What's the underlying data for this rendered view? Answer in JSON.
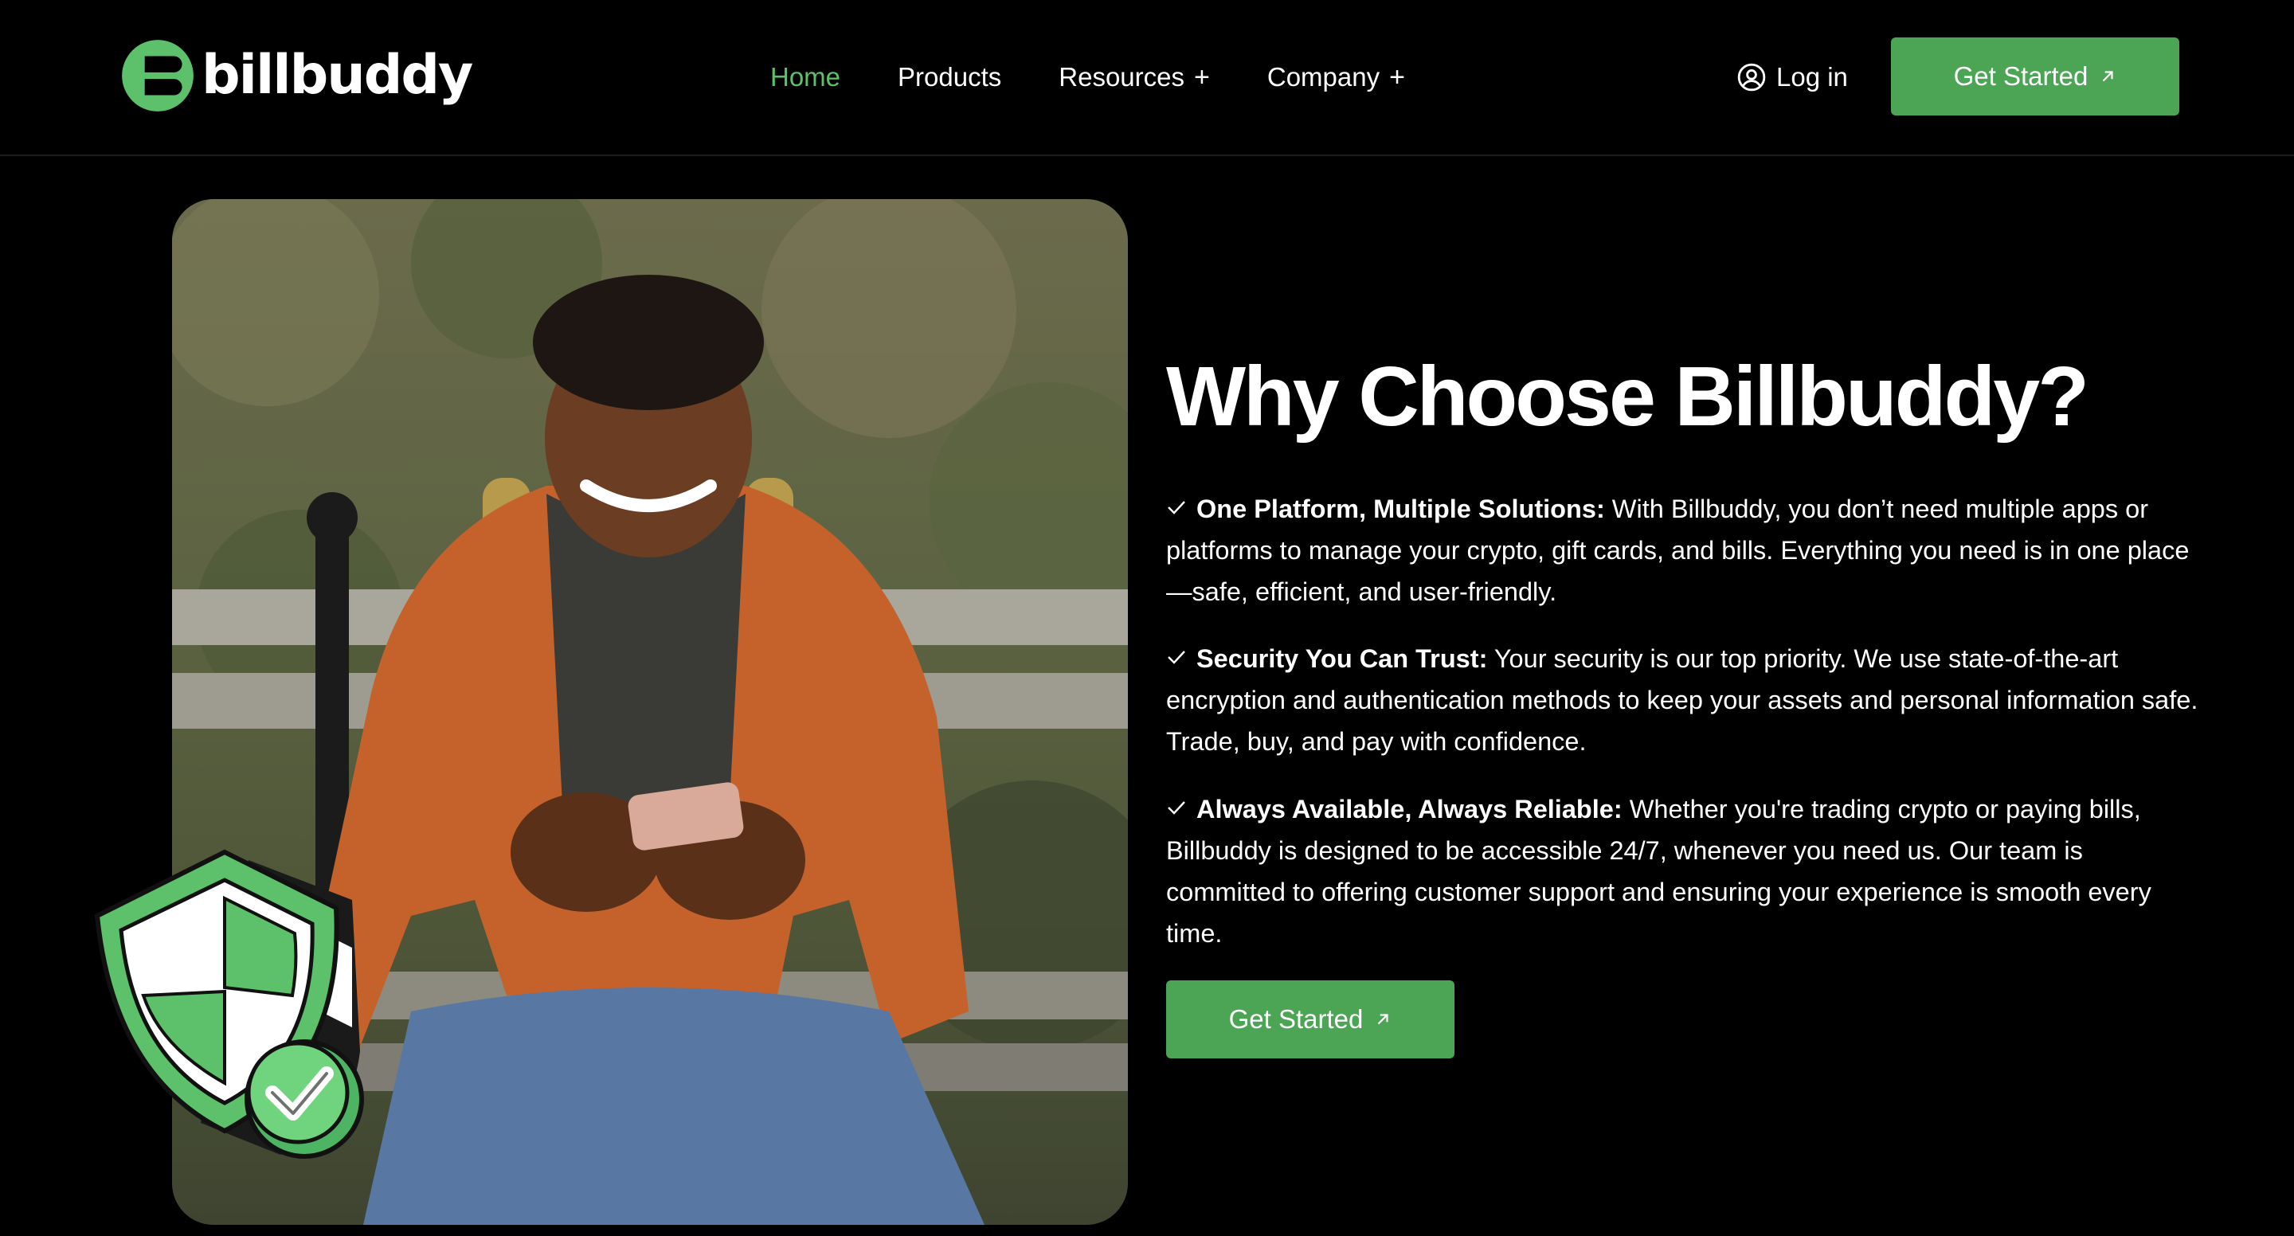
{
  "brand": {
    "name": "billbuddy",
    "accent_color": "#5cc16a",
    "button_color": "#4ba555"
  },
  "nav": {
    "links": [
      {
        "label": "Home",
        "active": true
      },
      {
        "label": "Products",
        "active": false
      },
      {
        "label": "Resources",
        "active": false,
        "suffix": "+"
      },
      {
        "label": "Company",
        "active": false,
        "suffix": "+"
      }
    ],
    "login_label": "Log in",
    "login_icon": "user-circle-icon",
    "cta_label": "Get Started",
    "cta_icon": "arrow-up-right-icon"
  },
  "hero": {
    "heading": "Why Choose Billbuddy?",
    "features": [
      {
        "title": "One Platform, Multiple Solutions:",
        "text": " With Billbuddy, you don’t need multiple apps or platforms to manage your crypto, gift cards, and bills. Everything you need is in one place—safe, efficient, and user-friendly."
      },
      {
        "title": "Security You Can Trust:",
        "text": " Your security is our top priority. We use state-of-the-art encryption and authentication methods to keep your assets and personal information safe. Trade, buy, and pay with confidence."
      },
      {
        "title": "Always Available, Always Reliable:",
        "text": " Whether you're trading crypto or paying bills, Billbuddy is designed to be accessible 24/7, whenever you need us. Our team is committed to offering customer support and ensuring your experience is smooth every time."
      }
    ],
    "cta_label": "Get Started",
    "image_icon": "shield-check-icon"
  }
}
